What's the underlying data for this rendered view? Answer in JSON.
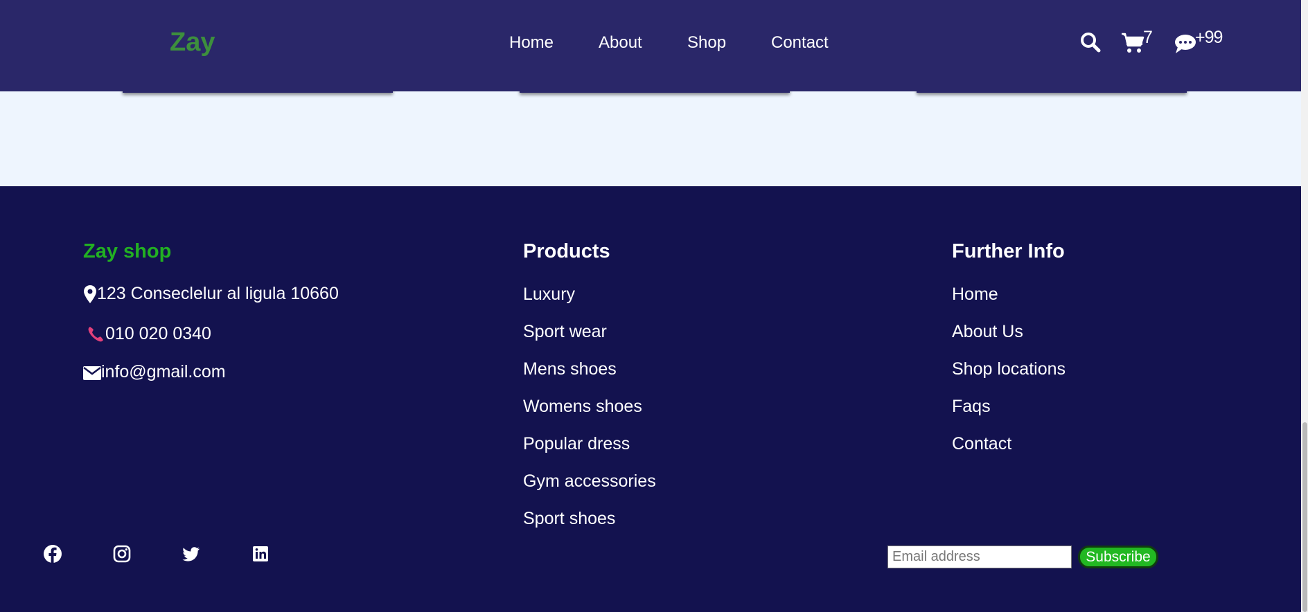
{
  "header": {
    "logo": "Zay",
    "nav": [
      "Home",
      "About",
      "Shop",
      "Contact"
    ],
    "cart_count": "7",
    "messages_count": "+99",
    "icons": [
      "search-icon",
      "cart-icon",
      "chat-icon"
    ]
  },
  "footer": {
    "brand_title": "Zay shop",
    "address": "123 Conseclelur al ligula 10660",
    "phone": "010 020 0340",
    "email": "info@gmail.com",
    "products_title": "Products",
    "products": [
      "Luxury",
      "Sport wear",
      "Mens shoes",
      "Womens shoes",
      "Popular dress",
      "Gym accessories",
      "Sport shoes"
    ],
    "info_title": "Further Info",
    "info_links": [
      "Home",
      "About Us",
      "Shop locations",
      "Faqs",
      "Contact"
    ],
    "social": [
      "facebook-icon",
      "instagram-icon",
      "twitter-icon",
      "linkedin-icon"
    ],
    "newsletter": {
      "placeholder": "Email address",
      "button": "Subscribe"
    }
  },
  "colors": {
    "header_bg": "#2a2769",
    "footer_bg": "#13124f",
    "band_bg": "#eef5fe",
    "logo_green": "#3d8f3d",
    "brand_green": "#22b022",
    "phone_pink": "#e0407a"
  }
}
